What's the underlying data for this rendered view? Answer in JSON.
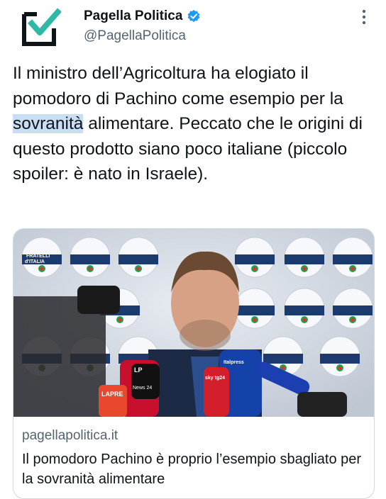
{
  "author": {
    "name": "Pagella Politica",
    "handle": "@PagellaPolitica",
    "avatar_icon": "ballot-check-logo-icon",
    "verified_icon": "verified-badge-icon",
    "menu_icon": "more-vertical-icon"
  },
  "tweet": {
    "text_before": "Il ministro dell’Agricoltura ha elogiato il pomodoro di Pachino come esempio per la ",
    "highlight": "sovranità",
    "text_after": " alimentare. Peccato che le origini di questo prodotto siano poco italiane (piccolo spoiler: è nato in Israele)."
  },
  "card": {
    "image_alt": "photo-minister-at-press-conference",
    "backdrop_logo_text": [
      "FRATELLI",
      "d'ITALIA"
    ],
    "mic_labels": [
      "LAPRE",
      "LP",
      "News 24",
      "sky tg24",
      "Italpress"
    ],
    "domain": "pagellapolitica.it",
    "title": "Il pomodoro Pachino è proprio l’esempio sbagliato per la sovranità alimentare"
  },
  "colors": {
    "accent_blue": "#1d9bf0",
    "highlight": "#c9def3",
    "logo_green": "#2fb8a5",
    "text_secondary": "#536471"
  }
}
